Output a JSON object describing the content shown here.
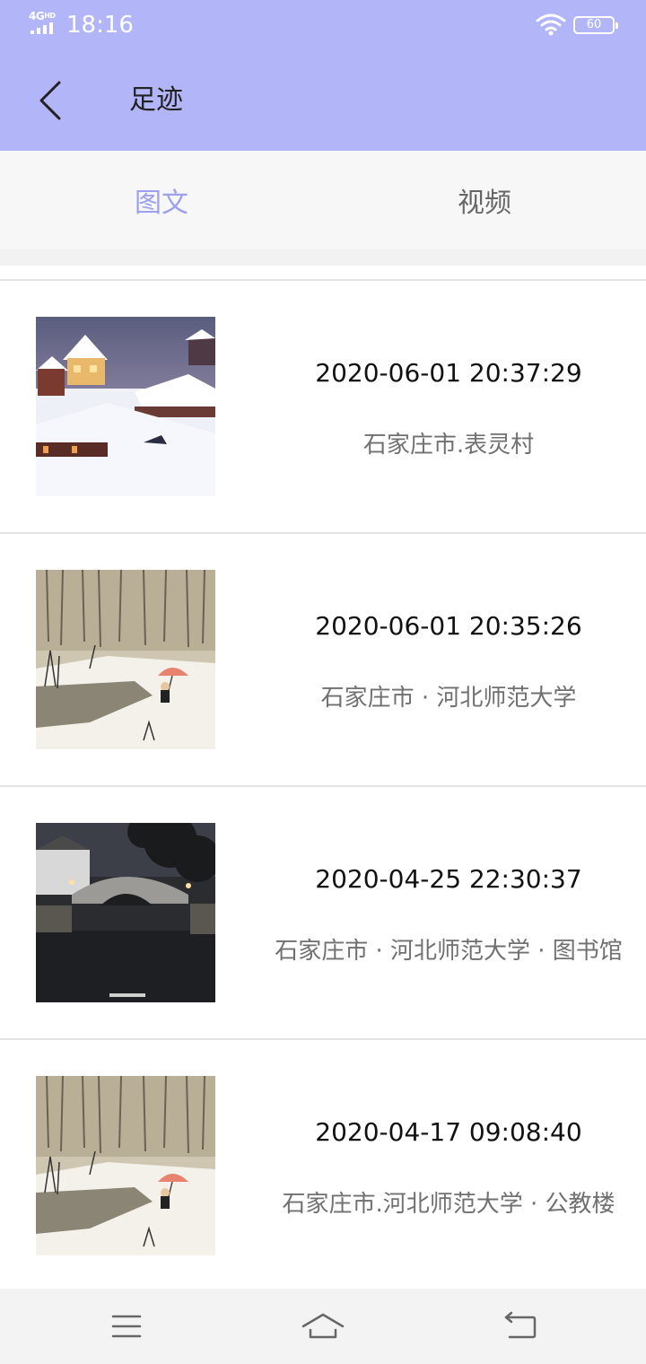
{
  "status_bar": {
    "network": "4G",
    "network_sub": "HD",
    "time": "18:16",
    "battery": "60"
  },
  "header": {
    "title": "足迹",
    "back_icon": "chevron-left-icon",
    "bg_color": "#b3b5f9"
  },
  "tabs": [
    {
      "label": "图文",
      "active": true
    },
    {
      "label": "视频",
      "active": false
    }
  ],
  "colors": {
    "accent": "#9ea0ee",
    "text_secondary": "#707070"
  },
  "records": [
    {
      "time": "2020-06-01 20:37:29",
      "place": "石家庄市.表灵村",
      "thumb": "snowy-village-photo"
    },
    {
      "time": "2020-06-01 20:35:26",
      "place": "石家庄市 · 河北师范大学",
      "thumb": "snowy-forest-umbrella-illustration"
    },
    {
      "time": "2020-04-25 22:30:37",
      "place": "石家庄市 · 河北师范大学 · 图书馆",
      "thumb": "night-bridge-moon-photo"
    },
    {
      "time": "2020-04-17 09:08:40",
      "place": "石家庄市.河北师范大学 · 公教楼",
      "thumb": "snowy-forest-umbrella-illustration"
    }
  ],
  "nav_bar": {
    "menu_icon": "menu-icon",
    "home_icon": "home-icon",
    "back_icon": "return-icon"
  }
}
